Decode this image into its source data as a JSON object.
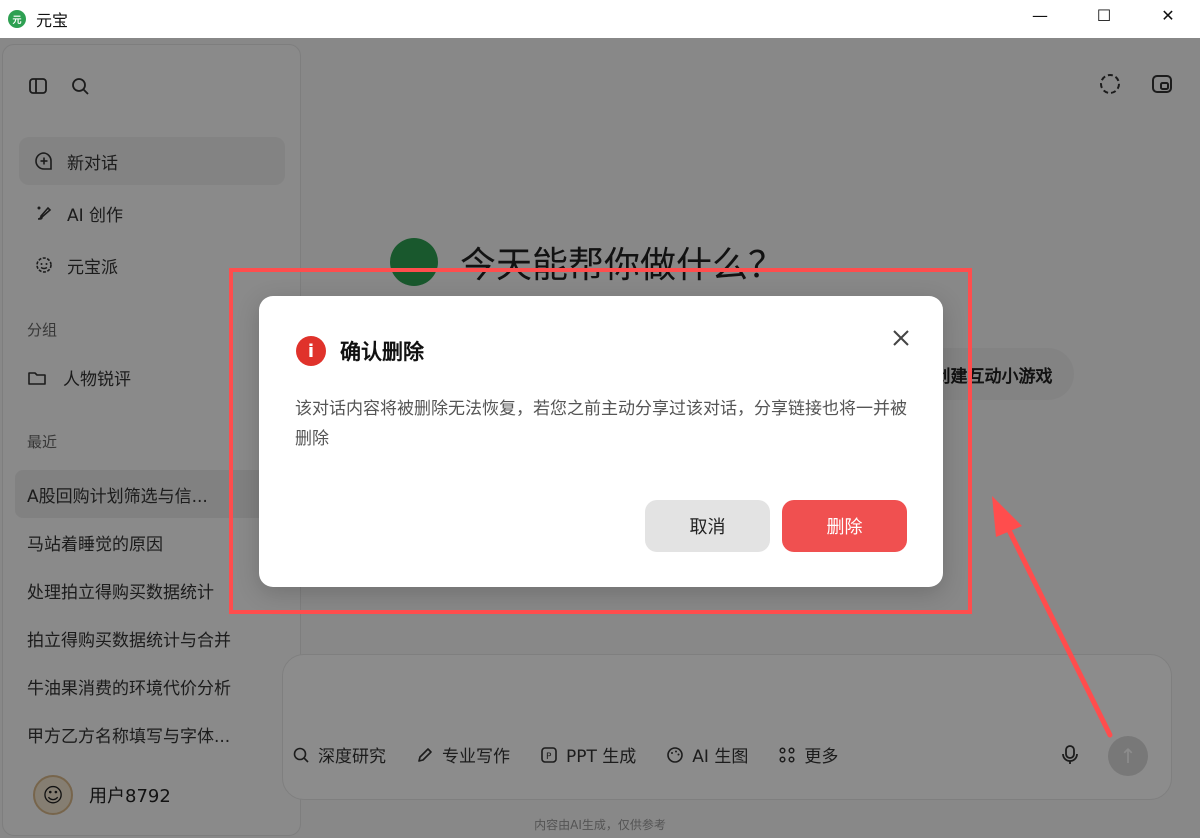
{
  "window": {
    "title": "元宝",
    "logo_text": "元",
    "controls": {
      "minimize": "—",
      "maximize": "☐",
      "close": "✕"
    }
  },
  "sidebar": {
    "nav": [
      {
        "label": "新对话",
        "icon": "chat-plus-icon",
        "active": true
      },
      {
        "label": "AI 创作",
        "icon": "brush-icon",
        "active": false
      },
      {
        "label": "元宝派",
        "icon": "gear-flower-icon",
        "active": false
      }
    ],
    "groups_title": "分组",
    "groups": [
      {
        "label": "人物锐评",
        "icon": "folder-icon"
      }
    ],
    "recent_title": "最近",
    "recent": [
      "A股回购计划筛选与信...",
      "马站着睡觉的原因",
      "处理拍立得购买数据统计",
      "拍立得购买数据统计与合并",
      "牛油果消费的环境代价分析",
      "甲方乙方名称填写与字体..."
    ],
    "user": {
      "name": "用户8792",
      "avatar_glyph": "☺"
    }
  },
  "main": {
    "greeting": "今天能帮你做什么？",
    "chip_label": "创建互动小游戏",
    "tools": [
      {
        "label": "深度研究",
        "icon": "research-icon"
      },
      {
        "label": "专业写作",
        "icon": "pen-icon"
      },
      {
        "label": "PPT 生成",
        "icon": "ppt-icon"
      },
      {
        "label": "AI 生图",
        "icon": "palette-icon"
      },
      {
        "label": "更多",
        "icon": "grid-icon"
      }
    ],
    "send_glyph": "↑",
    "footer_note": "内容由AI生成，仅供参考"
  },
  "dialog": {
    "title": "确认删除",
    "warn_glyph": "i",
    "message": "该对话内容将被删除无法恢复，若您之前主动分享过该对话，分享链接也将一并被删除",
    "cancel_label": "取消",
    "delete_label": "删除"
  },
  "colors": {
    "brand_green": "#2ea052",
    "danger": "#f05050",
    "annotation": "#ff4d4d"
  }
}
